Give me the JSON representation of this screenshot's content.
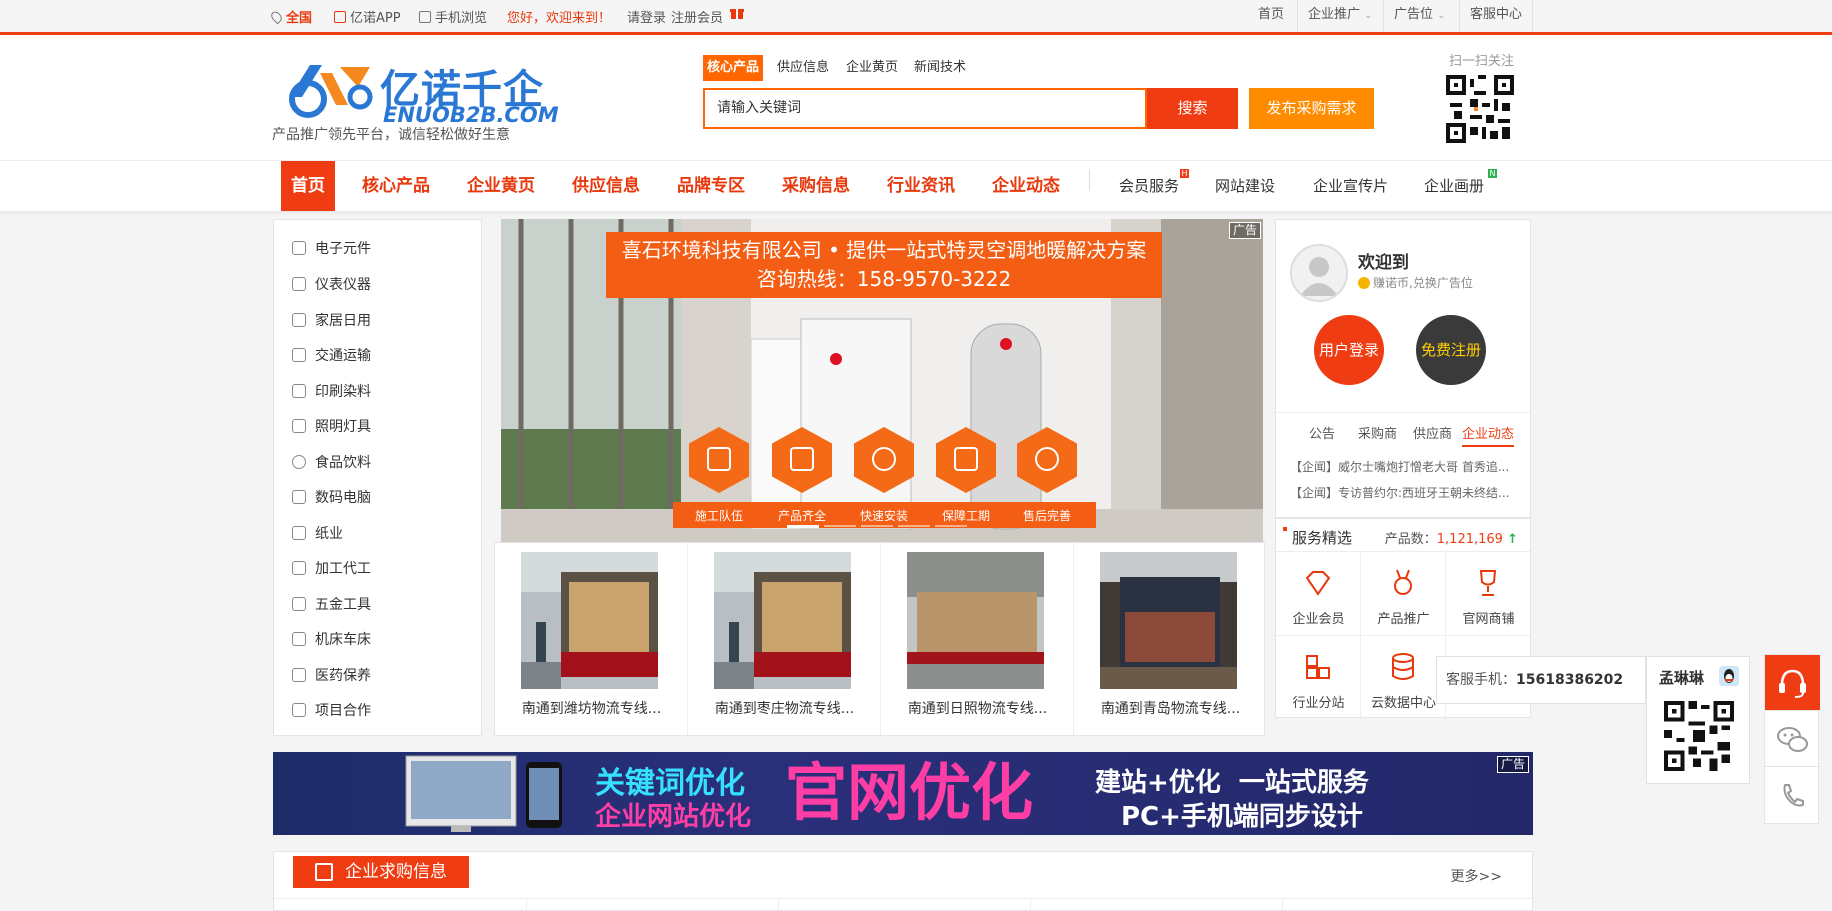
{
  "topbar": {
    "location": "全国",
    "app": "亿诺APP",
    "mobile": "手机浏览",
    "greeting": "您好，欢迎来到！",
    "login": "请登录",
    "register": "注册会员",
    "right": [
      "首页",
      "企业推广",
      "广告位",
      "客服中心"
    ]
  },
  "header": {
    "logo_cn": "亿诺千企",
    "logo_en": "ENUOB2B.COM",
    "slogan": "产品推广领先平台，诚信轻松做好生意",
    "search_tabs": [
      "核心产品",
      "供应信息",
      "企业黄页",
      "新闻技术"
    ],
    "search_placeholder": "请输入关键词",
    "search_button": "搜索",
    "publish_button": "发布采购需求",
    "qr_label": "扫一扫关注"
  },
  "nav": {
    "main": [
      "首页",
      "核心产品",
      "企业黄页",
      "供应信息",
      "品牌专区",
      "采购信息",
      "行业资讯",
      "企业动态"
    ],
    "secondary": [
      "会员服务",
      "网站建设",
      "企业宣传片",
      "企业画册"
    ],
    "badge_hot": "H",
    "badge_new": "N"
  },
  "categories": [
    "电子元件",
    "仪表仪器",
    "家居日用",
    "交通运输",
    "印刷染料",
    "照明灯具",
    "食品饮料",
    "数码电脑",
    "纸业",
    "加工代工",
    "五金工具",
    "机床车床",
    "医药保养",
    "项目合作"
  ],
  "banner": {
    "ad_tag": "广告",
    "line1": "喜石环境科技有限公司 • 提供一站式特灵空调地暖解决方案",
    "line2": "咨询热线：158-9570-3222",
    "labels": [
      "施工队伍",
      "产品齐全",
      "快速安装",
      "保障工期",
      "售后完善"
    ]
  },
  "products": [
    "南通到潍坊物流专线...",
    "南通到枣庄物流专线...",
    "南通到日照物流专线...",
    "南通到青岛物流专线..."
  ],
  "user": {
    "welcome": "欢迎到",
    "coin_text": "赚诺币,兑换广告位",
    "login_button": "用户登录",
    "register_button": "免费注册",
    "tabs": [
      "公告",
      "采购商",
      "供应商",
      "企业动态"
    ],
    "news": [
      "【企闻】威尔士嘴炮打憎老大哥 首秀追...",
      "【企闻】专访普约尔:西班牙王朝未终结..."
    ]
  },
  "service": {
    "title": "服务精选",
    "count_label": "产品数：",
    "count_value": "1,121,169",
    "items": [
      "企业会员",
      "产品推广",
      "官网商铺",
      "行业分站",
      "云数据中心"
    ]
  },
  "ad_banner": {
    "ad_tag": "广告",
    "t1": "关键词优化",
    "t2": "企业网站优化",
    "t3": "官网优化",
    "t4": "建站+优化  一站式服务",
    "t5": "PC+手机端同步设计"
  },
  "buy": {
    "title": "企业求购信息",
    "more": "更多>>"
  },
  "float": {
    "phone_label": "客服手机：",
    "phone": "15618386202",
    "agent": "孟琳琳"
  },
  "colors": {
    "accent": "#ef3c12",
    "orange": "#ff6600",
    "brand_blue": "#2a78d4"
  }
}
